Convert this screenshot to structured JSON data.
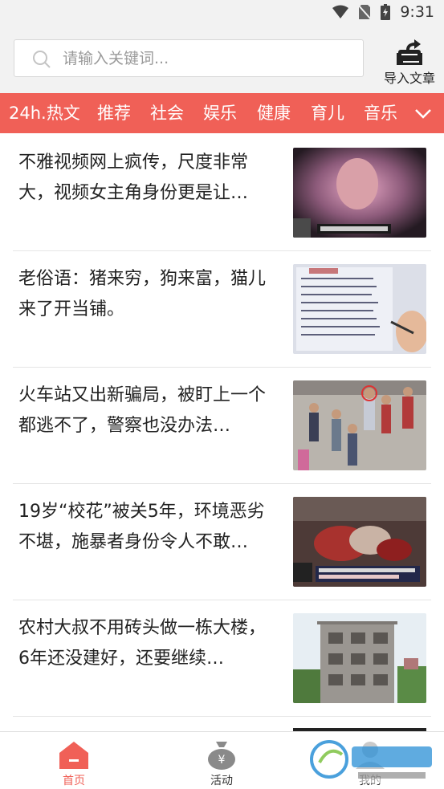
{
  "status_bar": {
    "time": "9:31"
  },
  "search": {
    "placeholder": "请输入关键词..."
  },
  "import": {
    "label": "导入文章"
  },
  "tabs": [
    {
      "label": "24h.热文"
    },
    {
      "label": "推荐"
    },
    {
      "label": "社会"
    },
    {
      "label": "娱乐"
    },
    {
      "label": "健康"
    },
    {
      "label": "育儿"
    },
    {
      "label": "音乐"
    }
  ],
  "articles": [
    {
      "title": "不雅视频网上疯传，尺度非常大，视频女主角身份更是让…"
    },
    {
      "title": "老俗语：猪来穷，狗来富，猫儿来了开当铺。"
    },
    {
      "title": "火车站又出新骗局，被盯上一个都逃不了，警察也没办法…"
    },
    {
      "title": "19岁“校花”被关5年，环境恶劣不堪，施暴者身份令人不敢…"
    },
    {
      "title": "农村大叔不用砖头做一栋大楼，6年还没建好，还要继续…"
    }
  ],
  "bottom_nav": [
    {
      "label": "首页",
      "active": true
    },
    {
      "label": "活动",
      "active": false
    },
    {
      "label": "我的",
      "active": false
    }
  ],
  "colors": {
    "accent": "#f06057",
    "header_bg": "#f2f2f2"
  }
}
